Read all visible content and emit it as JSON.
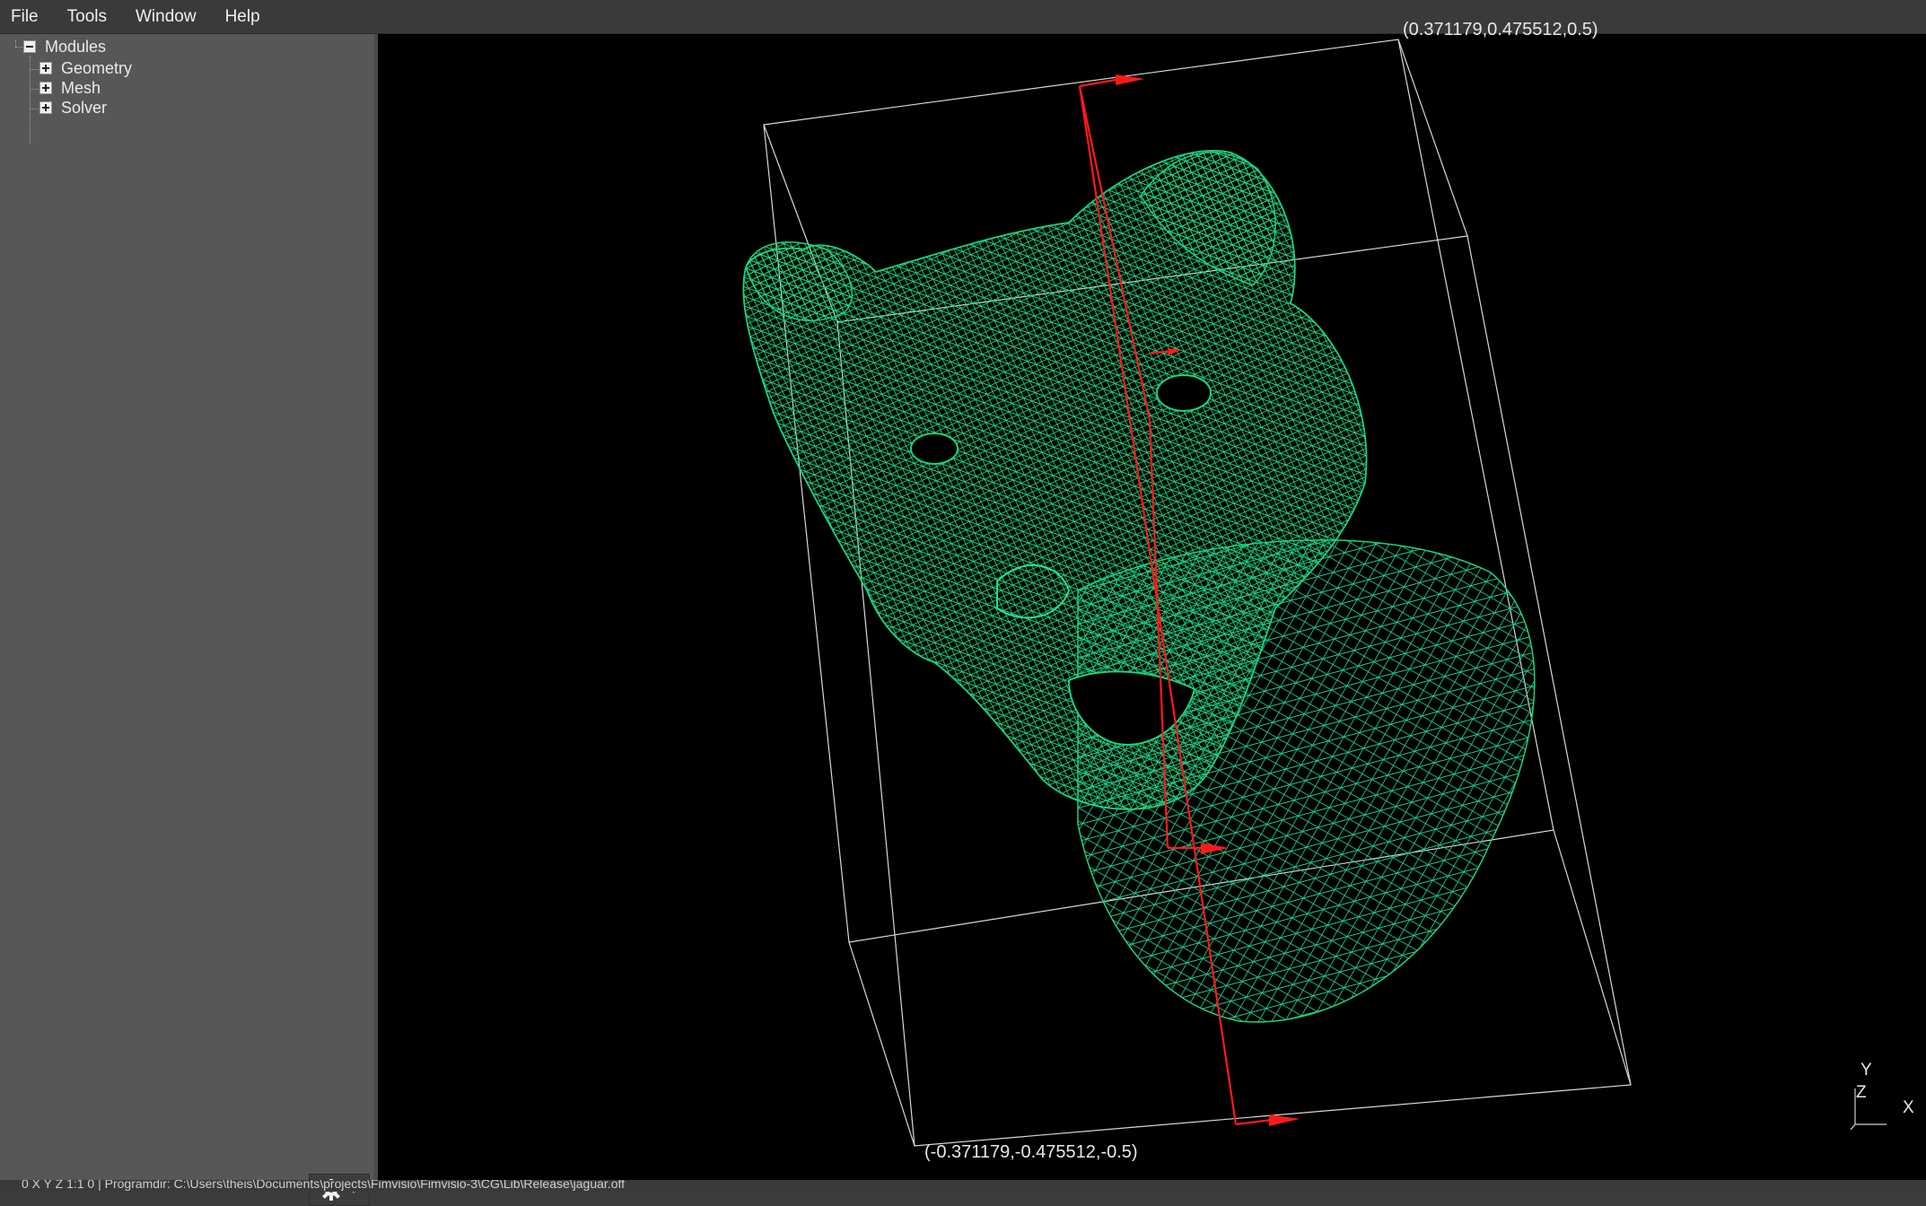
{
  "menu": {
    "file": "File",
    "tools": "Tools",
    "window": "Window",
    "help": "Help"
  },
  "tree": {
    "root": "Modules",
    "children": [
      "Geometry",
      "Mesh",
      "Solver"
    ]
  },
  "viewport": {
    "bbox_min_label": "(-0.371179,-0.475512,-0.5)",
    "bbox_max_label": "(0.371179,0.475512,0.5)",
    "mesh_color": "#1fd17a",
    "bbox_color": "#d8d8d8",
    "axis_color": "#ff1a1a",
    "axes": {
      "y": "Y",
      "z": "Z",
      "x": "X"
    }
  },
  "statusbar": {
    "text": "0  X  Y  Z  1:1  0   |   Programdir: C:\\Users\\theis\\Documents\\projects\\Fimvisio\\Fimvisio-3\\CG\\Lib\\Release\\jaguar.off"
  },
  "icons": {
    "settings": "gear-icon",
    "dropdown": "chevron-down-icon"
  }
}
